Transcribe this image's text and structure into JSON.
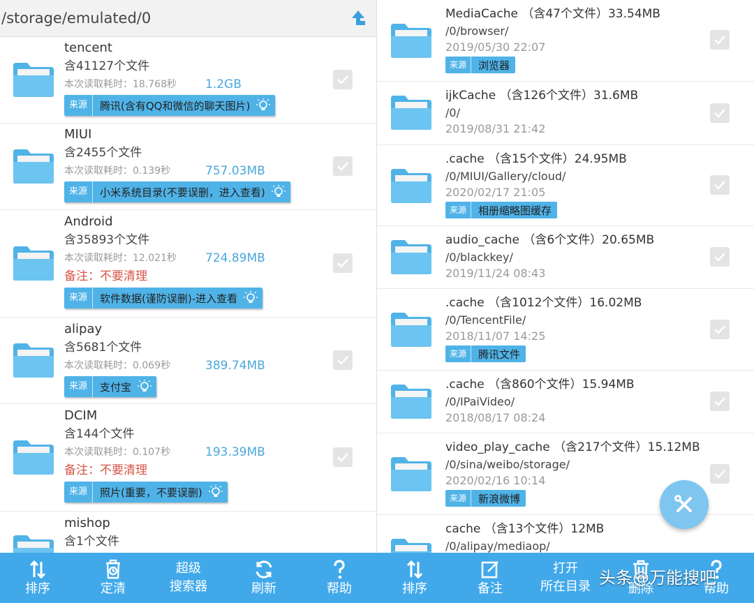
{
  "left": {
    "path": "/storage/emulated/0",
    "time_prefix": "本次读取耗时：",
    "source_label": "来源",
    "items": [
      {
        "name": "tencent",
        "count": "含41127个文件",
        "time": "18.768秒",
        "size": "1.2GB",
        "note": "",
        "tag": "腾讯(含有QQ和微信的聊天图片)"
      },
      {
        "name": "MIUI",
        "count": "含2455个文件",
        "time": "0.139秒",
        "size": "757.03MB",
        "note": "",
        "tag": "小米系统目录(不要误删，进入查看)"
      },
      {
        "name": "Android",
        "count": "含35893个文件",
        "time": "12.021秒",
        "size": "724.89MB",
        "note": "备注：不要清理",
        "tag": "软件数据(谨防误删)-进入查看"
      },
      {
        "name": "alipay",
        "count": "含5681个文件",
        "time": "0.069秒",
        "size": "389.74MB",
        "note": "",
        "tag": "支付宝"
      },
      {
        "name": "DCIM",
        "count": "含144个文件",
        "time": "0.107秒",
        "size": "193.39MB",
        "note": "备注：不要清理",
        "tag": "照片(重要，不要误删)"
      },
      {
        "name": "mishop",
        "count": "含1个文件"
      }
    ]
  },
  "right": {
    "source_label": "来源",
    "items": [
      {
        "name": "MediaCache （含47个文件）33.54MB",
        "path": "/0/browser/",
        "date": "2019/05/30 22:07",
        "tag": "浏览器"
      },
      {
        "name": "ijkCache （含126个文件）31.6MB",
        "path": "/0/",
        "date": "2019/08/31 21:42",
        "tag": ""
      },
      {
        "name": ".cache （含15个文件）24.95MB",
        "path": "/0/MIUI/Gallery/cloud/",
        "date": "2020/02/17 21:05",
        "tag": "相册缩略图缓存"
      },
      {
        "name": "audio_cache （含6个文件）20.65MB",
        "path": "/0/blackkey/",
        "date": "2019/11/24 08:43",
        "tag": ""
      },
      {
        "name": ".cache （含1012个文件）16.02MB",
        "path": "/0/TencentFile/",
        "date": "2018/11/07 14:25",
        "tag": "腾讯文件"
      },
      {
        "name": ".cache （含860个文件）15.94MB",
        "path": "/0/IPaiVideo/",
        "date": "2018/08/17 08:24",
        "tag": ""
      },
      {
        "name": "video_play_cache （含217个文件）15.12MB",
        "path": "/0/sina/weibo/storage/",
        "date": "2020/02/16 10:14",
        "tag": "新浪微博"
      },
      {
        "name": "cache （含13个文件）12MB",
        "path": "/0/alipay/mediaop/",
        "date": "",
        "tag": ""
      }
    ]
  },
  "bottom_left": {
    "sort": "排序",
    "scheduled": "定清",
    "super_search_1": "超级",
    "super_search_2": "搜索器",
    "refresh": "刷新",
    "help": "帮助"
  },
  "bottom_right": {
    "sort": "排序",
    "note": "备注",
    "open_1": "打开",
    "open_2": "所在目录",
    "delete": "删除",
    "help": "帮助"
  },
  "watermark": "头条@万能搜吧",
  "colors": {
    "accent": "#41a9ea",
    "folder": "#5ab9ea",
    "size": "#4aa7db",
    "note": "#d65544"
  }
}
